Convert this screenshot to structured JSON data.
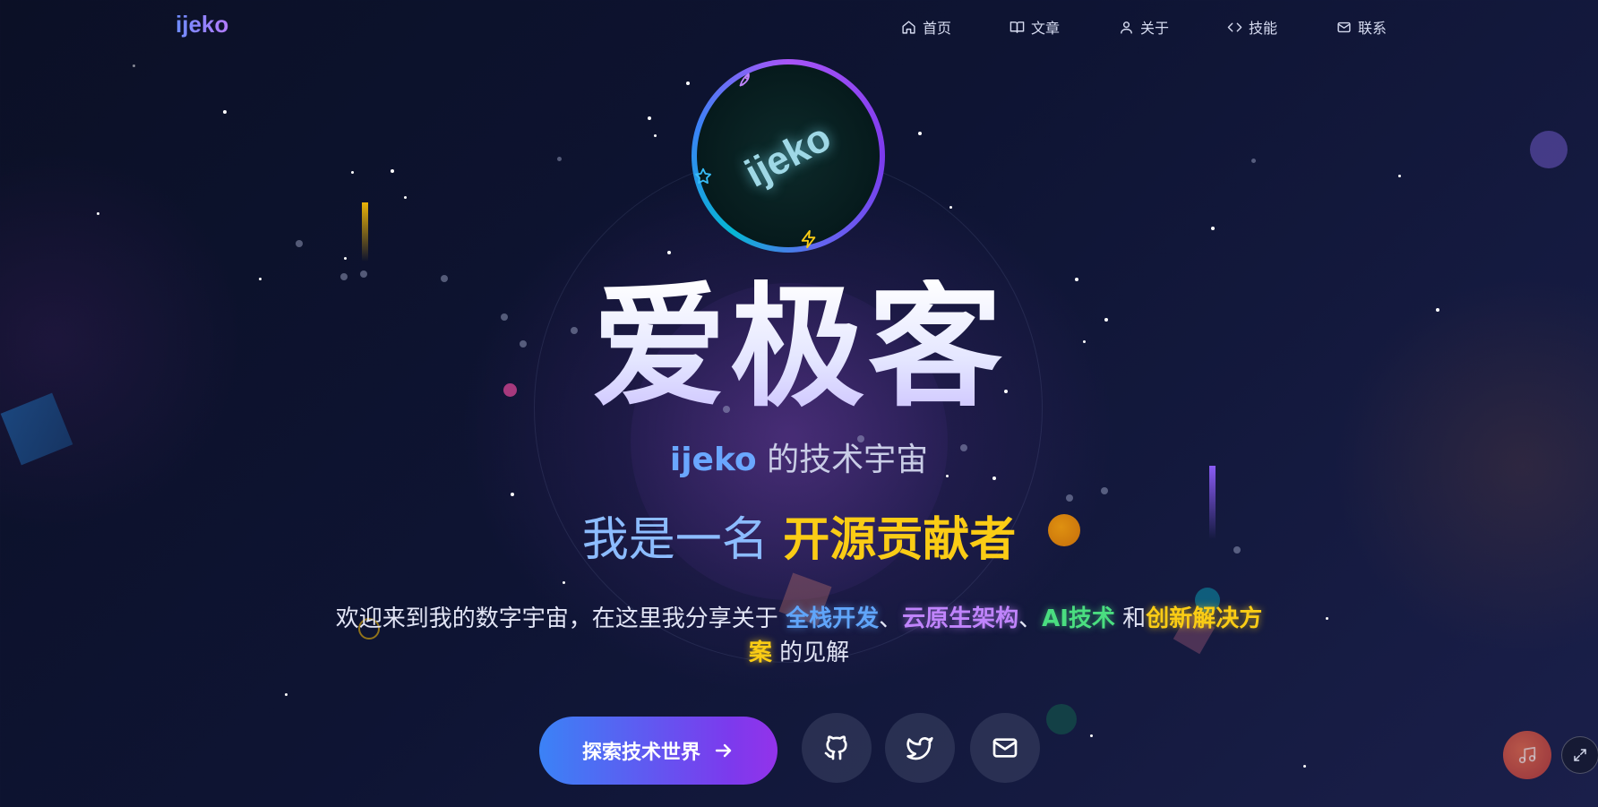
{
  "nav": {
    "logo": "ijeko",
    "items": [
      {
        "label": "首页",
        "icon": "home-icon"
      },
      {
        "label": "文章",
        "icon": "book-icon"
      },
      {
        "label": "关于",
        "icon": "user-icon"
      },
      {
        "label": "技能",
        "icon": "code-icon"
      },
      {
        "label": "联系",
        "icon": "mail-icon"
      }
    ]
  },
  "avatar": {
    "text": "ijeko"
  },
  "hero": {
    "title": "爱极客",
    "subtitle_brand": "ijeko",
    "subtitle_rest": " 的技术宇宙",
    "typing_lead": "我是一名 ",
    "typing_role": "开源贡献者"
  },
  "description": {
    "intro": "欢迎来到我的数字宇宙，在这里我分享关于 ",
    "tag1": "全栈开发",
    "sep1": "、",
    "tag2": "云原生架构",
    "sep2": "、",
    "tag3": "AI技术",
    "and": " 和",
    "tag4": "创新解决方案",
    "outro": " 的见解"
  },
  "actions": {
    "cta_label": "探索技术世界",
    "social": [
      "github-icon",
      "twitter-icon",
      "mail-icon"
    ]
  },
  "colors": {
    "accent_blue": "#3b82f6",
    "accent_purple": "#7c3aed",
    "highlight_yellow": "#facc15",
    "background": "#0e1433"
  }
}
